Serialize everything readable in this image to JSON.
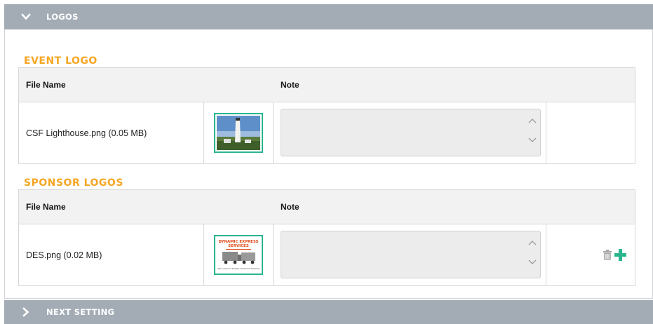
{
  "header": {
    "logos_label": "LOGOS",
    "next_label": "NEXT SETTING"
  },
  "event_logo": {
    "title": "EVENT LOGO",
    "columns": {
      "file_name": "File Name",
      "note": "Note"
    },
    "row": {
      "file_name": "CSF Lighthouse.png (0.05 MB)",
      "note_value": ""
    }
  },
  "sponsor_logos": {
    "title": "SPONSOR LOGOS",
    "columns": {
      "file_name": "File Name",
      "note": "Note"
    },
    "row": {
      "file_name": "DES.png (0.02 MB)",
      "note_value": "",
      "thumb_text_1": "DYNAMIC EXPRESS",
      "thumb_text_2": "SERVICES",
      "thumb_text_3": "The Leader in Freight and Parcel Delivery"
    }
  },
  "icons": {
    "logos_toggle": "chevron-down-icon",
    "next_toggle": "chevron-right-icon",
    "delete": "trash-icon",
    "add": "plus-icon",
    "scroll_up": "chevron-up-icon",
    "scroll_down": "chevron-down-icon"
  },
  "colors": {
    "header_bg": "#a3acb5",
    "section_title": "#f5a623",
    "thumb_border": "#2bb58f",
    "add_icon": "#2bb58f",
    "trash_icon": "#a6a6a6"
  }
}
